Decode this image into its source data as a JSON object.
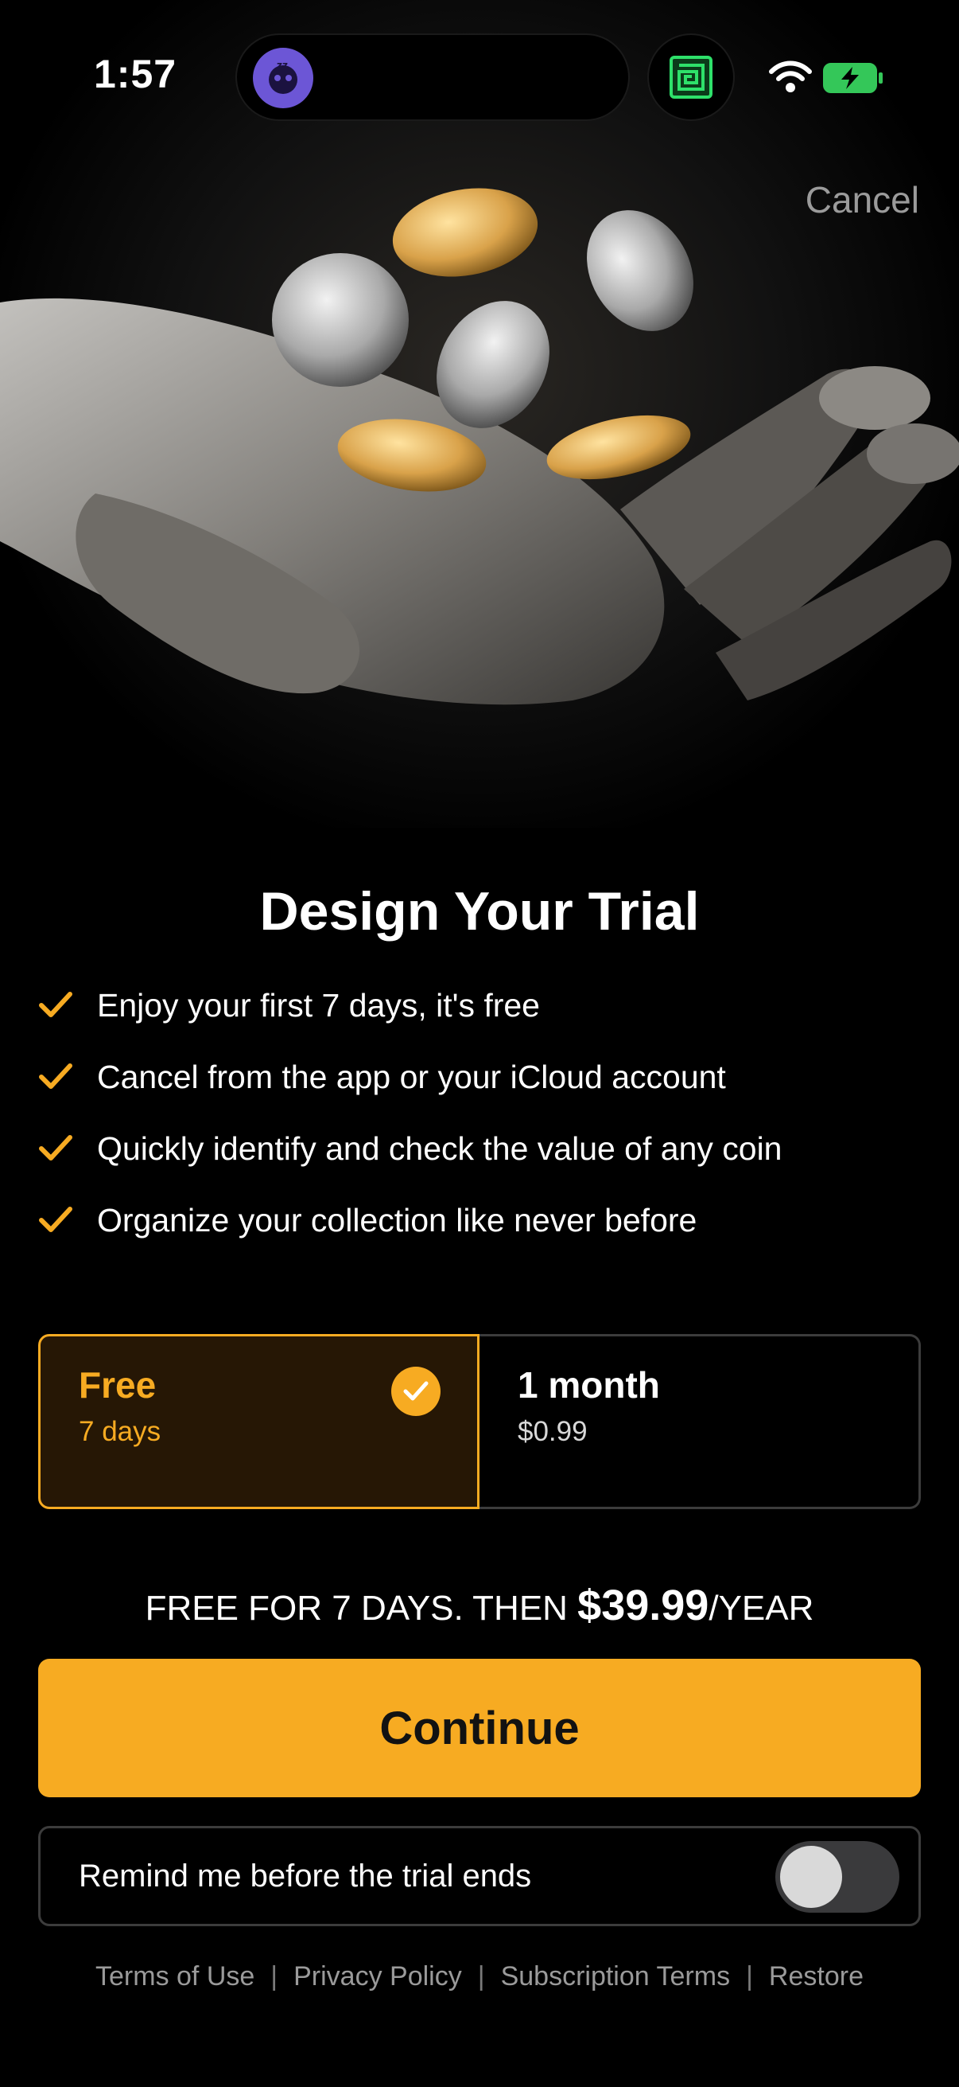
{
  "status_bar": {
    "time": "1:57"
  },
  "header": {
    "cancel_label": "Cancel"
  },
  "title": "Design Your Trial",
  "features": [
    "Enjoy your first 7 days, it's free",
    "Cancel from the app or your iCloud account",
    "Quickly identify and check the value of any coin",
    "Organize your collection like never before"
  ],
  "plans": [
    {
      "name": "Free",
      "sub": "7 days",
      "selected": true
    },
    {
      "name": "1 month",
      "sub": "$0.99",
      "selected": false
    }
  ],
  "pricing": {
    "prefix": "FREE FOR 7 DAYS. THEN ",
    "amount": "$39.99",
    "suffix": "/YEAR"
  },
  "continue_label": "Continue",
  "reminder": {
    "label": "Remind me before the trial ends",
    "enabled": false
  },
  "footer_links": [
    "Terms of Use",
    "Privacy Policy",
    "Subscription Terms",
    "Restore"
  ],
  "colors": {
    "accent": "#f7ab22",
    "background": "#000000",
    "selected_plan_bg": "#261705"
  }
}
